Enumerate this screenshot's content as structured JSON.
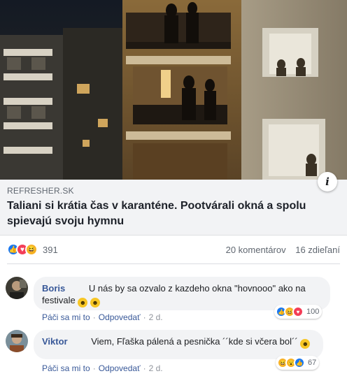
{
  "post": {
    "info_glyph": "i",
    "preview": {
      "domain": "REFRESHER.SK",
      "headline": "Taliani si krátia čas v karanténe. Pootvárali okná a spolu spievajú svoju hymnu"
    },
    "stats": {
      "reaction_icons": [
        "like-icon",
        "love-icon",
        "haha-icon"
      ],
      "reaction_count": "391",
      "comments": "20 komentárov",
      "shares": "16 zdieľaní"
    }
  },
  "comments": [
    {
      "author": "Boris",
      "text": "U nás by sa ozvalo z kazdeho okna \"hovnooo\" ako na festivale",
      "emojis": [
        "grinning-emoji",
        "grinning-emoji"
      ],
      "reactions": [
        "like-icon",
        "haha-icon",
        "love-icon"
      ],
      "reaction_count": "100",
      "actions": {
        "like": "Páči sa mi to",
        "reply": "Odpovedať",
        "time": "2 d."
      }
    },
    {
      "author": "Viktor",
      "text": "Viem, Fľaška pálená a pesnička ´´kde si včera bol´´",
      "emojis": [
        "grinning-emoji"
      ],
      "reactions": [
        "haha-icon",
        "wow-icon",
        "like-icon"
      ],
      "reaction_count": "67",
      "actions": {
        "like": "Páči sa mi to",
        "reply": "Odpovedať",
        "time": "2 d."
      }
    }
  ],
  "colors": {
    "link": "#385898",
    "like": "#1877f2",
    "love": "#f33e58",
    "haha": "#f7b125",
    "bubble": "#f2f3f5"
  }
}
